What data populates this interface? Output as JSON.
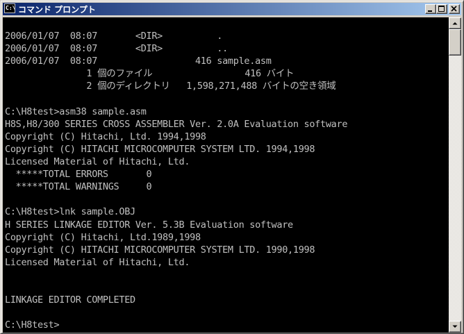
{
  "window": {
    "title": "コマンド プロンプト",
    "app_icon_text": "C:\\",
    "titlebar_colors": [
      "#0a246a",
      "#a6caf0"
    ]
  },
  "title_buttons": {
    "minimize": "minimize-icon",
    "maximize": "maximize-icon",
    "close": "close-icon"
  },
  "console": {
    "foreground": "#c0c0c0",
    "background": "#000000",
    "lines": [
      "",
      "2006/01/07  08:07       <DIR>          .",
      "2006/01/07  08:07       <DIR>          ..",
      "2006/01/07  08:07                  416 sample.asm",
      "               1 個のファイル                 416 バイト",
      "               2 個のディレクトリ   1,598,271,488 バイトの空き領域",
      "",
      "C:\\H8test>asm38 sample.asm",
      "H8S,H8/300 SERIES CROSS ASSEMBLER Ver. 2.0A Evaluation software",
      "Copyright (C) Hitachi, Ltd. 1994,1998",
      "Copyright (C) HITACHI MICROCOMPUTER SYSTEM LTD. 1994,1998",
      "Licensed Material of Hitachi, Ltd.",
      "  *****TOTAL ERRORS       0",
      "  *****TOTAL WARNINGS     0",
      "",
      "C:\\H8test>lnk sample.OBJ",
      "H SERIES LINKAGE EDITOR Ver. 5.3B Evaluation software",
      "Copyright (C) Hitachi, Ltd.1989,1998",
      "Copyright (C) HITACHI MICROCOMPUTER SYSTEM LTD. 1990,1998",
      "Licensed Material of Hitachi, Ltd.",
      "",
      "",
      "LINKAGE EDITOR COMPLETED",
      "",
      "C:\\H8test>"
    ]
  },
  "scrollbar": {
    "up": "scroll-up-arrow-icon",
    "down": "scroll-down-arrow-icon"
  }
}
